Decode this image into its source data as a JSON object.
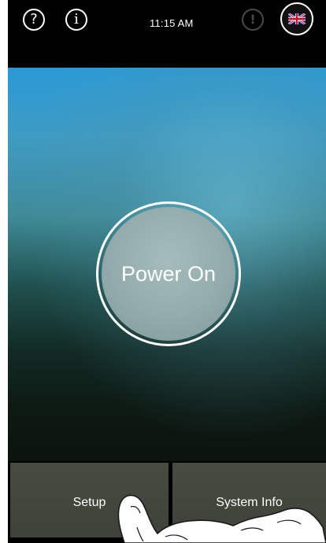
{
  "statusbar": {
    "help_icon": "?",
    "info_icon": "i",
    "alert_icon": "!",
    "time": "11:15 AM"
  },
  "main": {
    "power_label": "Power On"
  },
  "bottom": {
    "setup_label": "Setup",
    "system_info_label": "System Info"
  },
  "colors": {
    "accent_top": "#2a9ad6",
    "button_bg": "#474b40",
    "power_fill": "#93abac"
  },
  "icons": {
    "help": "question-circle-icon",
    "info": "info-circle-icon",
    "alert": "exclamation-circle-icon",
    "language": "uk-flag-icon"
  }
}
